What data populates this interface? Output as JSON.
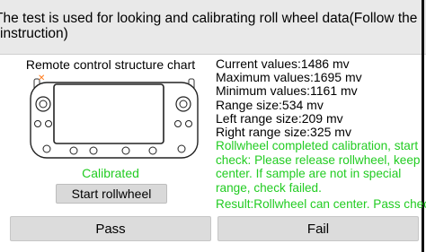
{
  "header": {
    "instruction": "The test is used for looking and calibrating roll wheel data(Follow the instruction)"
  },
  "left_panel": {
    "chart_title": "Remote control structure chart",
    "device_image": "remote-controller-illustration",
    "calibration_status": "Calibrated",
    "start_button_label": "Start rollwheel"
  },
  "values": {
    "current": "Current values:1486 mv",
    "maximum": "Maximum values:1695 mv",
    "minimum": "Minimum values:1161 mv",
    "range": "Range size:534 mv",
    "left_range": "Left range size:209 mv",
    "right_range": "Right range size:325 mv"
  },
  "status_message": "Rollwheel completed calibration, start check: Please release rollwheel, keep center. If sample are not in special range, check failed.",
  "result_message": "Result:Rollwheel can center. Pass check",
  "footer": {
    "pass_label": "Pass",
    "fail_label": "Fail"
  },
  "colors": {
    "status_green": "#22cc22",
    "header_bg": "#e9e9e9",
    "button_bg": "#dcdcdc",
    "marker_orange": "#ff7a1a"
  }
}
